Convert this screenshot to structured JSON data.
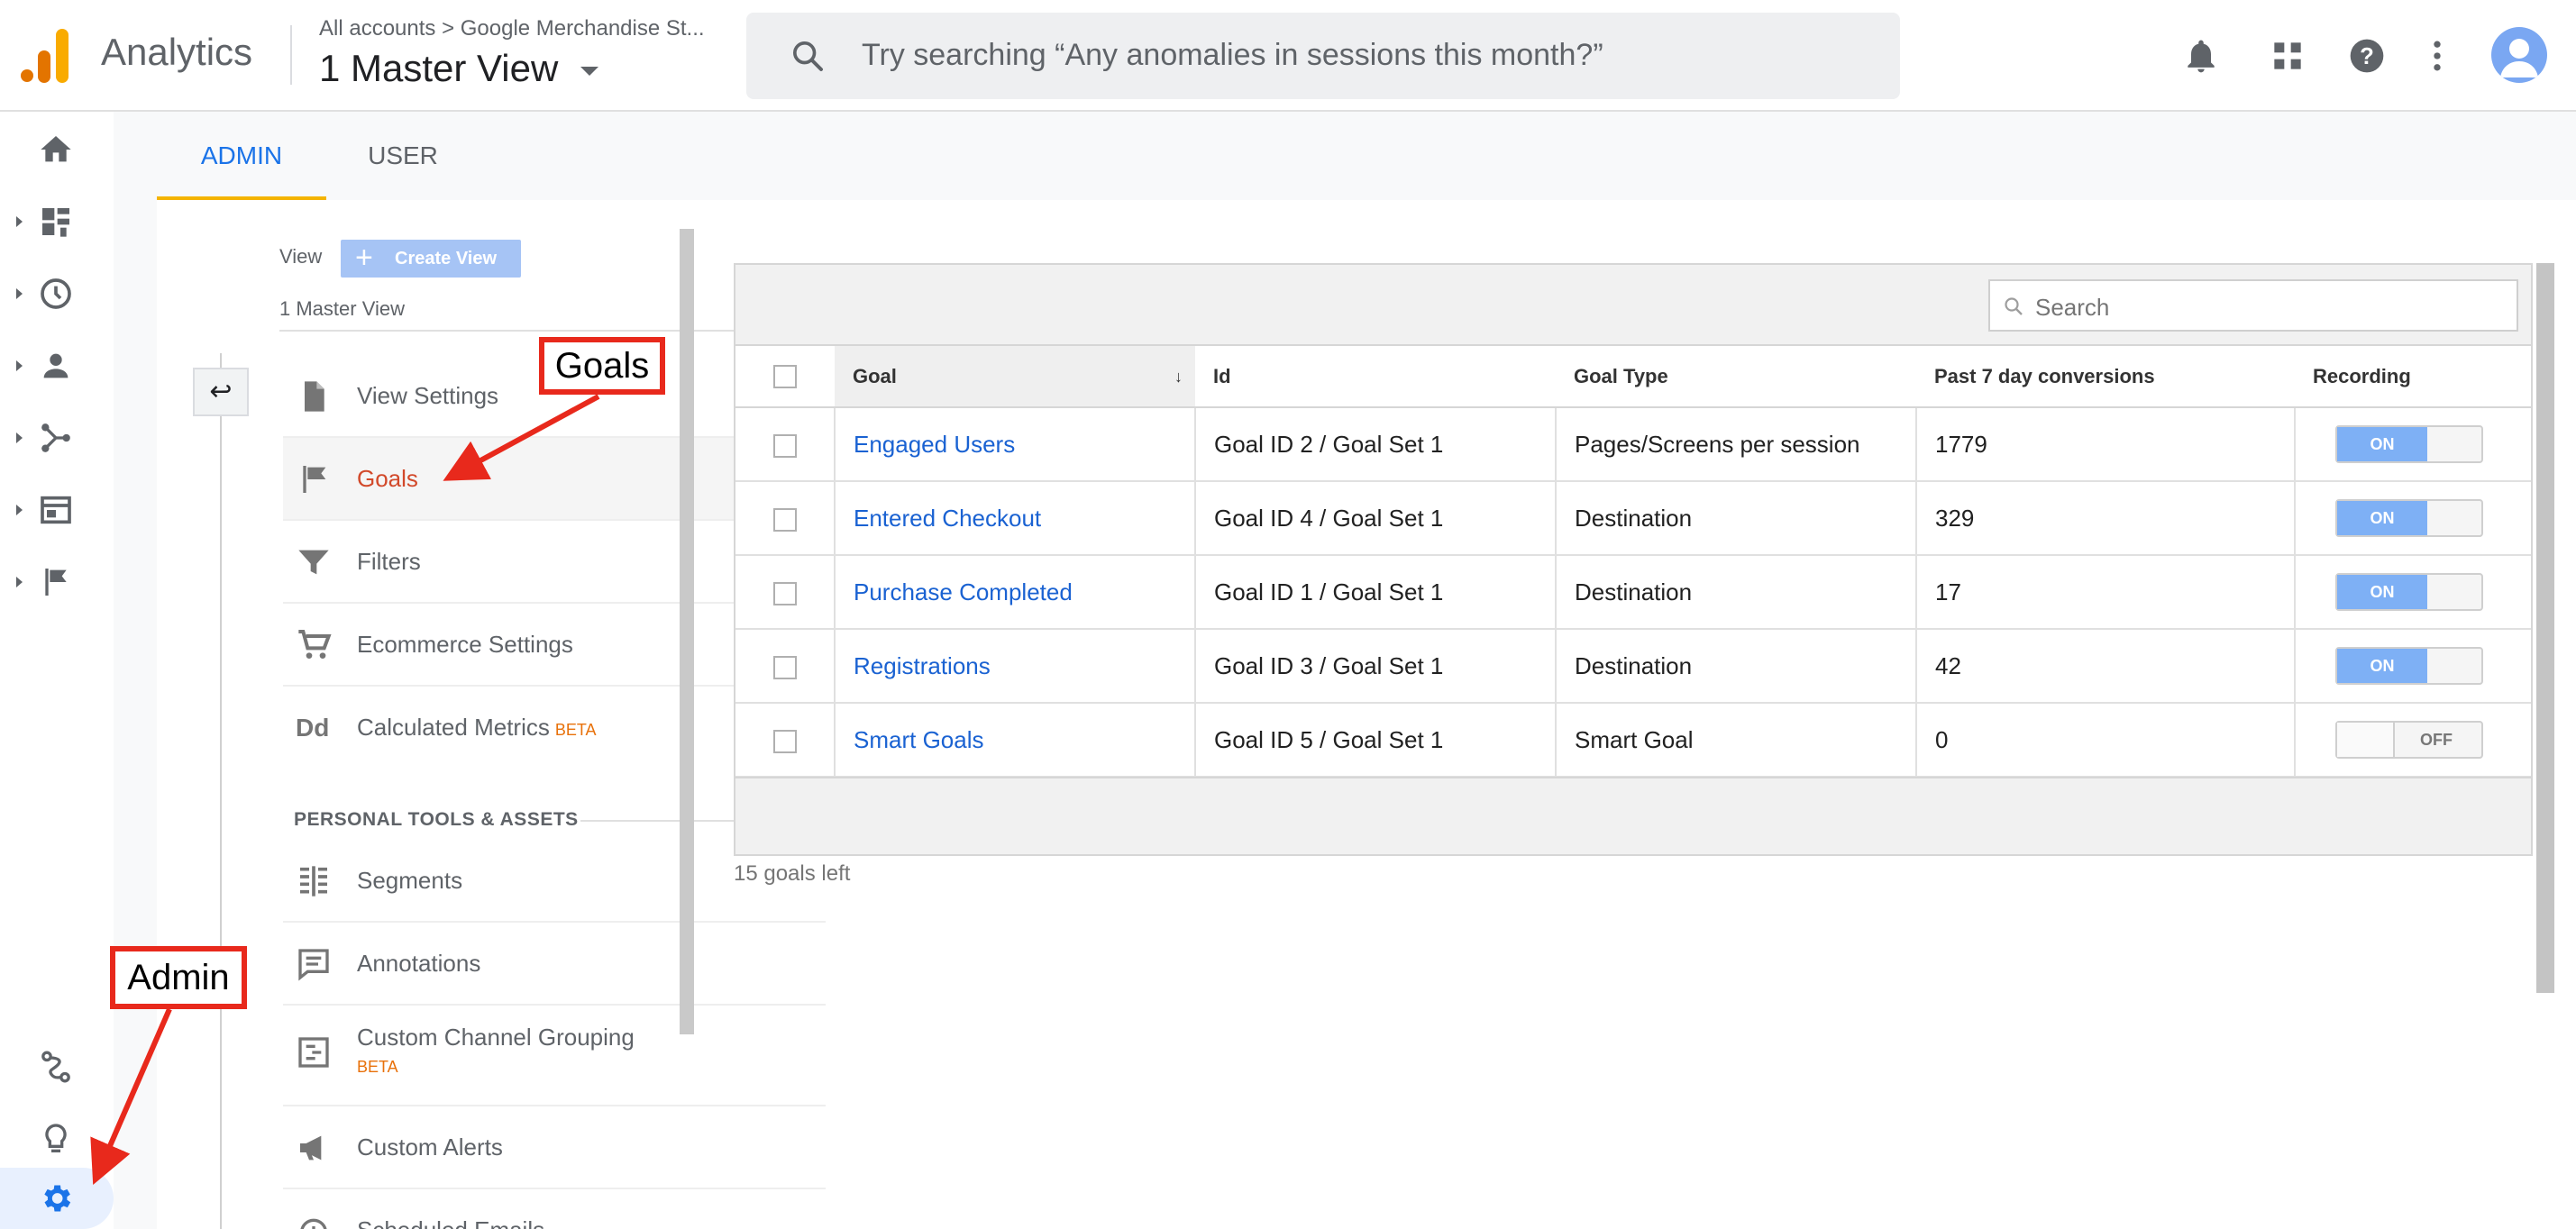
{
  "header": {
    "app_title": "Analytics",
    "breadcrumb": "All accounts > Google Merchandise St...",
    "view_title": "1 Master View",
    "search_placeholder": "Try searching “Any anomalies in sessions this month?”",
    "icons": [
      "notifications-icon",
      "apps-icon",
      "help-icon",
      "more-vert-icon",
      "account-avatar"
    ]
  },
  "leftnav": {
    "items": [
      "home-icon",
      "customization-icon",
      "realtime-icon",
      "audience-icon",
      "acquisition-icon",
      "behavior-icon",
      "conversions-icon"
    ],
    "bottom": [
      "attribution-icon",
      "discover-icon",
      "admin-gear-icon"
    ]
  },
  "tabs": {
    "admin": "ADMIN",
    "user": "USER"
  },
  "panel": {
    "view_label": "View",
    "create_view": "Create View",
    "master_view": "1 Master View",
    "menu": [
      {
        "label": "View Settings",
        "icon": "document-icon"
      },
      {
        "label": "Goals",
        "icon": "flag-icon"
      },
      {
        "label": "Filters",
        "icon": "filter-icon"
      },
      {
        "label": "Ecommerce Settings",
        "icon": "cart-icon"
      },
      {
        "label": "Calculated Metrics",
        "icon": "dd-icon",
        "badge": "BETA"
      }
    ],
    "section_heading": "PERSONAL TOOLS & ASSETS",
    "tools": [
      {
        "label": "Segments",
        "icon": "segments-icon"
      },
      {
        "label": "Annotations",
        "icon": "annotations-icon"
      },
      {
        "label": "Custom Channel Grouping",
        "icon": "channel-grouping-icon",
        "badge": "BETA"
      },
      {
        "label": "Custom Alerts",
        "icon": "megaphone-icon"
      },
      {
        "label": "Scheduled Emails",
        "icon": "clock-icon"
      }
    ]
  },
  "table": {
    "search_placeholder": "Search",
    "columns": [
      "Goal",
      "Id",
      "Goal Type",
      "Past 7 day conversions",
      "Recording"
    ],
    "rows": [
      {
        "goal": "Engaged Users",
        "id": "Goal ID 2 / Goal Set 1",
        "type": "Pages/Screens per session",
        "conversions": "1779",
        "recording": "ON"
      },
      {
        "goal": "Entered Checkout",
        "id": "Goal ID 4 / Goal Set 1",
        "type": "Destination",
        "conversions": "329",
        "recording": "ON"
      },
      {
        "goal": "Purchase Completed",
        "id": "Goal ID 1 / Goal Set 1",
        "type": "Destination",
        "conversions": "17",
        "recording": "ON"
      },
      {
        "goal": "Registrations",
        "id": "Goal ID 3 / Goal Set 1",
        "type": "Destination",
        "conversions": "42",
        "recording": "ON"
      },
      {
        "goal": "Smart Goals",
        "id": "Goal ID 5 / Goal Set 1",
        "type": "Smart Goal",
        "conversions": "0",
        "recording": "OFF"
      }
    ],
    "goals_left": "15 goals left"
  },
  "annotations": {
    "goals": "Goals",
    "admin": "Admin"
  },
  "colors": {
    "accent": "#1a73e8",
    "active_menu": "#d2492a",
    "callout": "#e8291c",
    "toggle_on": "#7eb0f5"
  }
}
